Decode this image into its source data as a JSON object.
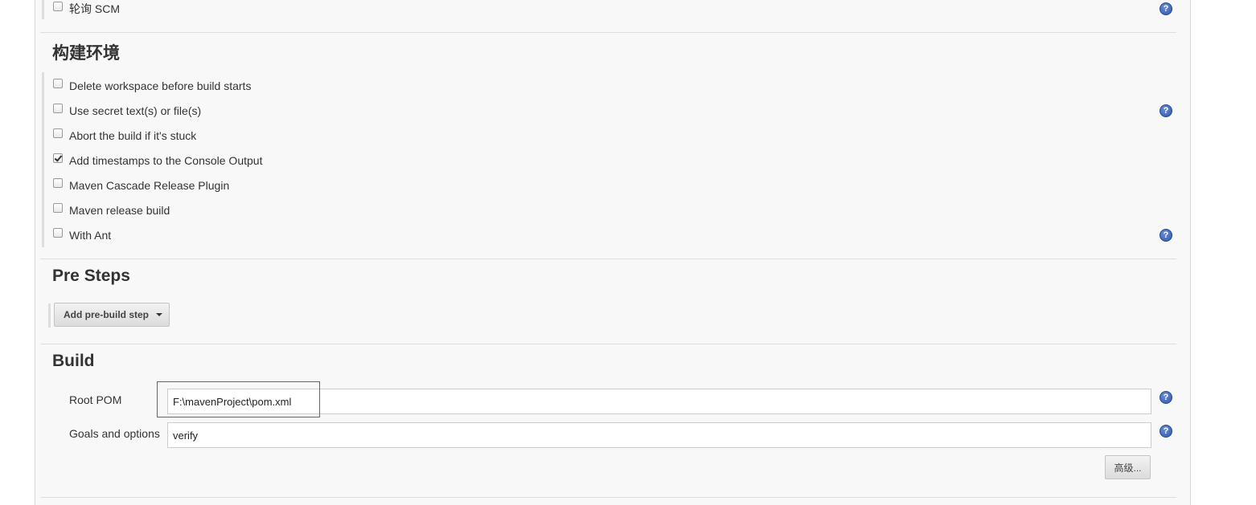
{
  "top_item": {
    "label": "轮询 SCM",
    "checked": false
  },
  "build_env": {
    "title": "构建环境",
    "options": [
      {
        "label": "Delete workspace before build starts",
        "checked": false
      },
      {
        "label": "Use secret text(s) or file(s)",
        "checked": false
      },
      {
        "label": "Abort the build if it's stuck",
        "checked": false
      },
      {
        "label": "Add timestamps to the Console Output",
        "checked": true
      },
      {
        "label": "Maven Cascade Release Plugin",
        "checked": false
      },
      {
        "label": "Maven release build",
        "checked": false
      },
      {
        "label": "With Ant",
        "checked": false
      }
    ]
  },
  "pre_steps": {
    "title": "Pre Steps",
    "add_button": "Add pre-build step"
  },
  "build": {
    "title": "Build",
    "root_pom_label": "Root POM",
    "root_pom_value": "F:\\mavenProject\\pom.xml",
    "goals_label": "Goals and options",
    "goals_value": "verify",
    "advanced_button": "高级..."
  },
  "help_glyph": "?",
  "icons": [
    "help-icon",
    "dropdown-caret-icon",
    "checkbox"
  ],
  "colors": {
    "panel_bg": "#f8f8f8",
    "help_icon": "#2f55a8",
    "highlight": "#e03030"
  }
}
